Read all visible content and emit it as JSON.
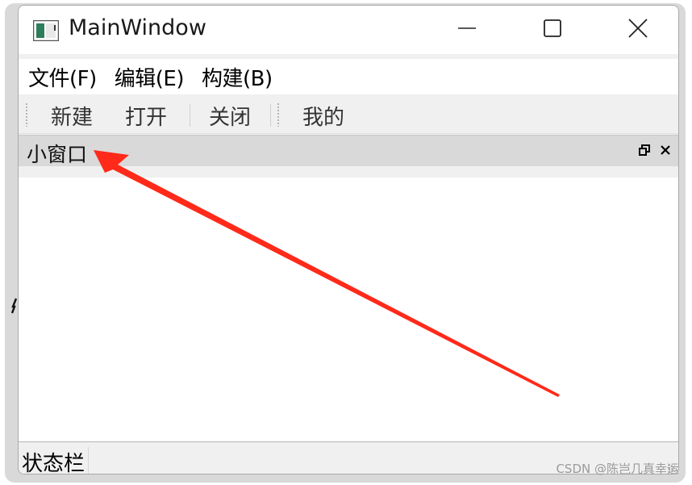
{
  "window": {
    "title": "MainWindow"
  },
  "menubar": {
    "items": [
      {
        "label": "文件(F)"
      },
      {
        "label": "编辑(E)"
      },
      {
        "label": "构建(B)"
      }
    ]
  },
  "toolbar": {
    "buttons": [
      {
        "label": "新建"
      },
      {
        "label": "打开"
      },
      {
        "label": "关闭"
      },
      {
        "label": "我的"
      }
    ]
  },
  "dock": {
    "title": "小窗口"
  },
  "statusbar": {
    "text": "状态栏"
  },
  "watermark": {
    "text": "CSDN @陈岂几真幸运"
  },
  "icons": {
    "app": "app-window-icon",
    "minimize": "minimize-icon",
    "maximize": "maximize-icon",
    "close": "close-icon",
    "dock_float": "float-icon",
    "dock_close": "dock-close-icon"
  },
  "colors": {
    "arrow": "#ff2a1a",
    "dock_title_bg": "#d9d9d9",
    "window_bg": "#f0f0f0"
  }
}
